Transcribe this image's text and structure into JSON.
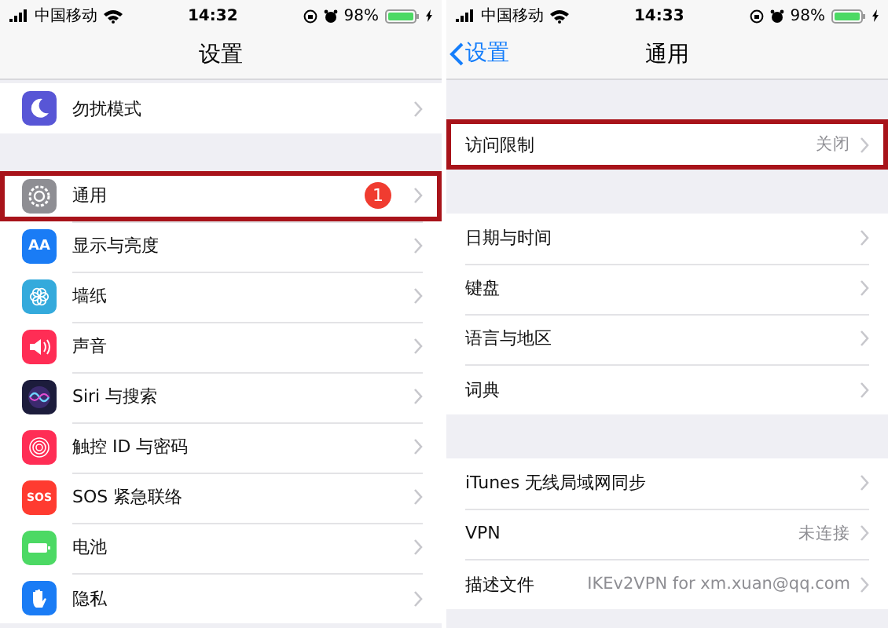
{
  "screens": [
    {
      "status_bar": {
        "carrier": "中国移动",
        "time": "14:32",
        "battery": "98%"
      },
      "nav": {
        "title": "设置"
      },
      "sections": [
        {
          "rows": [
            {
              "kind": "moon",
              "label": "勿扰模式",
              "highlighted": false
            }
          ]
        },
        {
          "rows": [
            {
              "kind": "gear",
              "label": "通用",
              "badge": "1",
              "highlighted": true
            },
            {
              "kind": "display",
              "icon_text": "AA",
              "label": "显示与亮度",
              "highlighted": false
            },
            {
              "kind": "wallpaper",
              "label": "墙纸",
              "highlighted": false
            },
            {
              "kind": "sound",
              "label": "声音",
              "highlighted": false
            },
            {
              "kind": "siri",
              "label": "Siri 与搜索",
              "highlighted": false
            },
            {
              "kind": "touchid",
              "label": "触控 ID 与密码",
              "highlighted": false
            },
            {
              "kind": "sos",
              "icon_text": "SOS",
              "label": "SOS 紧急联络",
              "highlighted": false
            },
            {
              "kind": "battery",
              "label": "电池",
              "highlighted": false
            },
            {
              "kind": "privacy",
              "label": "隐私",
              "highlighted": false
            }
          ]
        }
      ]
    },
    {
      "status_bar": {
        "carrier": "中国移动",
        "time": "14:33",
        "battery": "98%"
      },
      "nav": {
        "back": "设置",
        "title": "通用"
      },
      "sections": [
        {
          "rows": [
            {
              "label": "访问限制",
              "value": "关闭",
              "highlighted": true
            }
          ]
        },
        {
          "rows": [
            {
              "label": "日期与时间",
              "highlighted": false
            },
            {
              "label": "键盘",
              "highlighted": false
            },
            {
              "label": "语言与地区",
              "highlighted": false
            },
            {
              "label": "词典",
              "highlighted": false
            }
          ]
        },
        {
          "rows": [
            {
              "label": "iTunes 无线局域网同步",
              "highlighted": false
            },
            {
              "label": "VPN",
              "value": "未连接",
              "highlighted": false
            },
            {
              "label": "描述文件",
              "value": "IKEv2VPN for xm.xuan@qq.com",
              "highlighted": false
            }
          ]
        }
      ]
    }
  ]
}
